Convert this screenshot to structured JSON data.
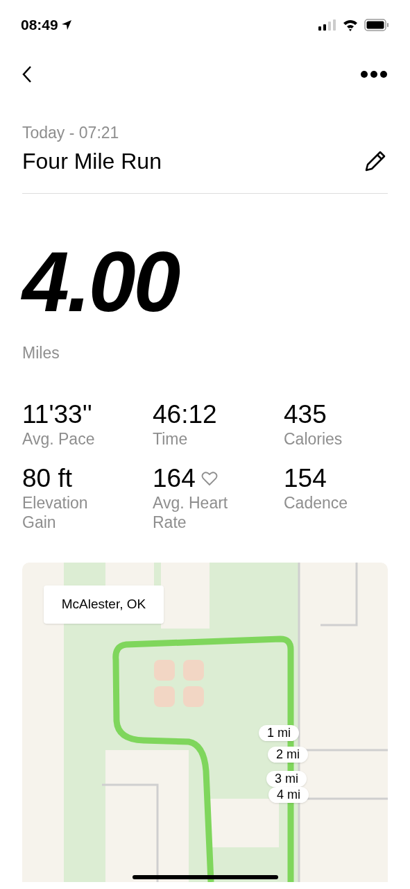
{
  "status_bar": {
    "time": "08:49"
  },
  "activity": {
    "date": "Today - 07:21",
    "title": "Four Mile Run"
  },
  "distance": {
    "value": "4.00",
    "unit": "Miles"
  },
  "stats": [
    {
      "value": "11'33''",
      "label": "Avg. Pace",
      "kind": "plain"
    },
    {
      "value": "46:12",
      "label": "Time",
      "kind": "plain"
    },
    {
      "value": "435",
      "label": "Calories",
      "kind": "plain"
    },
    {
      "value": "80 ft",
      "label": "Elevation Gain",
      "kind": "plain"
    },
    {
      "value": "164",
      "label": "Avg. Heart Rate",
      "kind": "with_icon"
    },
    {
      "value": "154",
      "label": "Cadence",
      "kind": "plain"
    }
  ],
  "map": {
    "location": "McAlester, OK",
    "markers": [
      "1 mi",
      "2 mi",
      "3 mi",
      "4 mi"
    ]
  }
}
